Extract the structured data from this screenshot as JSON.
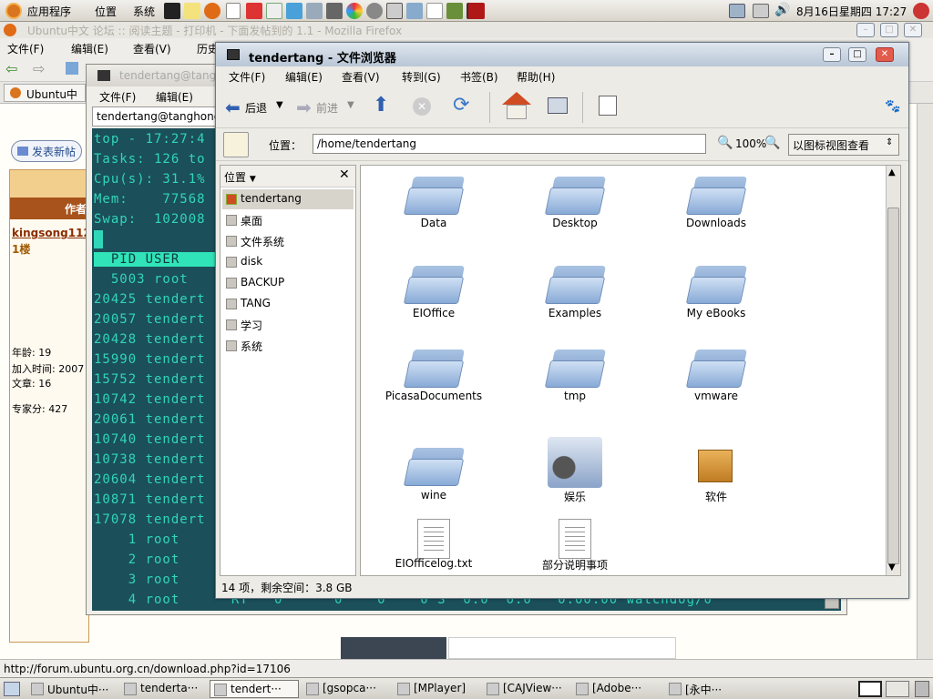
{
  "top_panel": {
    "menu_apps": "应用程序",
    "menu_places": "位置",
    "menu_system": "系统",
    "clock": "8月16日星期四  17:27"
  },
  "firefox": {
    "title": "Ubuntu中文 论坛 :: 阅读主题 - 打印机 - 下面发帖到的 1.1 - Mozilla Firefox",
    "menu": [
      "文件(F)",
      "编辑(E)",
      "查看(V)",
      "历史"
    ],
    "tab_label": "Ubuntu中文",
    "post_button": "发表新帖",
    "post_button_tail": "新贴",
    "author_header": "作者",
    "username": "kingsong112",
    "floor": "1楼",
    "age": "年龄: 19",
    "join_time": "加入时间: 2007",
    "posts": "文章: 16",
    "expert_score": "专家分: 427",
    "status_url": "http://forum.ubuntu.org.cn/download.php?id=17106"
  },
  "terminal": {
    "title": "tendertang@tang",
    "menu": [
      "文件(F)",
      "编辑(E)"
    ],
    "tab": "tendertang@tanghong",
    "lines": [
      "top - 17:27:4",
      "Tasks: 126 to",
      "Cpu(s): 31.1%",
      "Mem:    77568",
      "Swap:  102008"
    ],
    "header": "  PID USER    ",
    "rows": [
      "  5003 root",
      "20425 tendert",
      "20057 tendert",
      "20428 tendert",
      "15990 tendert",
      "15752 tendert",
      "10742 tendert",
      "20061 tendert",
      "10740 tendert",
      "10738 tendert",
      "20604 tendert",
      "10871 tendert",
      "17078 tendert",
      "    1 root",
      "    2 root",
      "    3 root",
      "    4 root      RT   0      0    0    0 S  0.0  0.0   0:00.00 watchdog/0"
    ]
  },
  "nautilus": {
    "title": "tendertang - 文件浏览器",
    "menu": [
      "文件(F)",
      "编辑(E)",
      "查看(V)",
      "转到(G)",
      "书签(B)",
      "帮助(H)"
    ],
    "back_label": "后退",
    "forward_label": "前进",
    "location_label": "位置：",
    "location_value": "/home/tendertang",
    "zoom": "100%",
    "view_mode": "以图标视图查看",
    "side_header": "位置",
    "side_items": [
      "tendertang",
      "桌面",
      "文件系统",
      "disk",
      "BACKUP",
      "TANG",
      "学习",
      "系统"
    ],
    "files": [
      {
        "name": "Data",
        "type": "folder"
      },
      {
        "name": "Desktop",
        "type": "folder"
      },
      {
        "name": "Downloads",
        "type": "folder"
      },
      {
        "name": "EIOffice",
        "type": "folder"
      },
      {
        "name": "Examples",
        "type": "folder"
      },
      {
        "name": "My eBooks",
        "type": "folder"
      },
      {
        "name": "PicasaDocuments",
        "type": "folder"
      },
      {
        "name": "tmp",
        "type": "folder"
      },
      {
        "name": "vmware",
        "type": "folder"
      },
      {
        "name": "wine",
        "type": "folder"
      },
      {
        "name": "娱乐",
        "type": "media"
      },
      {
        "name": "软件",
        "type": "package"
      },
      {
        "name": "EIOfficelog.txt",
        "type": "text"
      },
      {
        "name": "部分说明事项",
        "type": "text"
      }
    ],
    "status": "14 项，剩余空间：3.8 GB"
  },
  "taskbar": [
    {
      "label": "Ubuntu中···",
      "active": false
    },
    {
      "label": "tenderta···",
      "active": false
    },
    {
      "label": "tendert···",
      "active": true
    },
    {
      "label": "[gsopca···",
      "active": false
    },
    {
      "label": "[MPlayer]",
      "active": false
    },
    {
      "label": "[CAJView···",
      "active": false
    },
    {
      "label": "[Adobe···",
      "active": false
    },
    {
      "label": "[永中···",
      "active": false
    }
  ]
}
